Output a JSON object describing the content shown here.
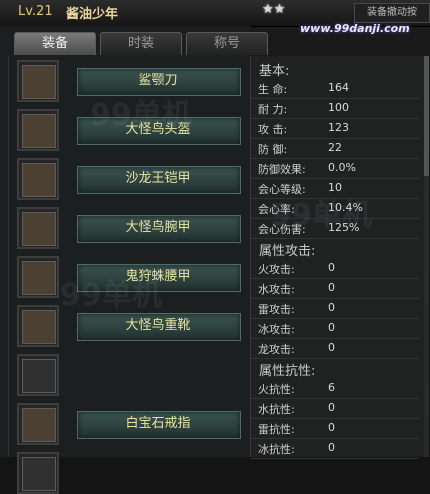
{
  "header": {
    "level": "Lv.21",
    "player_name": "酱油少年",
    "stars": "★★",
    "compare_button": "装备撤动按",
    "watermark": "www.99danji.com"
  },
  "tabs": [
    "装备",
    "时装",
    "称号"
  ],
  "slots": [
    {
      "name": "鲨颚刀",
      "icon": "sword-icon",
      "filled": true
    },
    {
      "name": "大怪鸟头盔",
      "icon": "helmet-icon",
      "filled": true
    },
    {
      "name": "沙龙王铠甲",
      "icon": "chest-armor-icon",
      "filled": true
    },
    {
      "name": "大怪鸟腕甲",
      "icon": "gauntlet-icon",
      "filled": true
    },
    {
      "name": "鬼狩蛛腰甲",
      "icon": "waist-armor-icon",
      "filled": true
    },
    {
      "name": "大怪鸟重靴",
      "icon": "boots-icon",
      "filled": true
    },
    {
      "name": "",
      "icon": "empty-slot-icon",
      "filled": false
    },
    {
      "name": "白宝石戒指",
      "icon": "ring-icon",
      "filled": true
    },
    {
      "name": "",
      "icon": "empty-slot-icon",
      "filled": false
    }
  ],
  "stats": {
    "basic_title": "基本:",
    "basic": [
      {
        "label": "生 命:",
        "value": "164"
      },
      {
        "label": "耐 力:",
        "value": "100"
      },
      {
        "label": "攻 击:",
        "value": "123"
      },
      {
        "label": "防 御:",
        "value": "22"
      },
      {
        "label": "防御效果:",
        "value": "0.0%"
      },
      {
        "label": "会心等级:",
        "value": "10"
      },
      {
        "label": "会心率:",
        "value": "10.4%"
      },
      {
        "label": "会心伤害:",
        "value": "125%"
      }
    ],
    "attack_title": "属性攻击:",
    "attack": [
      {
        "label": "火攻击:",
        "value": "0"
      },
      {
        "label": "水攻击:",
        "value": "0"
      },
      {
        "label": "雷攻击:",
        "value": "0"
      },
      {
        "label": "冰攻击:",
        "value": "0"
      },
      {
        "label": "龙攻击:",
        "value": "0"
      }
    ],
    "resist_title": "属性抗性:",
    "resist": [
      {
        "label": "火抗性:",
        "value": "6"
      },
      {
        "label": "水抗性:",
        "value": "0"
      },
      {
        "label": "雷抗性:",
        "value": "0"
      },
      {
        "label": "冰抗性:",
        "value": "0"
      }
    ]
  },
  "colors": {
    "item_name": "#e8e3a0",
    "level": "#e8c66a",
    "plate": "#3c5552"
  }
}
